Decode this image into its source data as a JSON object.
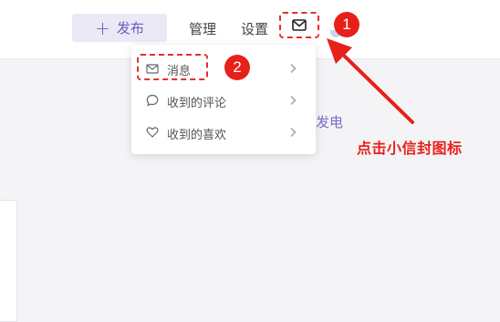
{
  "header": {
    "publish_label": "发布",
    "manage_label": "管理",
    "settings_label": "设置"
  },
  "dropdown": {
    "items": [
      {
        "label": "消息",
        "icon": "mail-icon"
      },
      {
        "label": "收到的评论",
        "icon": "comment-bubble-icon"
      },
      {
        "label": "收到的喜欢",
        "icon": "heart-icon"
      }
    ]
  },
  "background_text": "发电",
  "annotations": {
    "step1": "1",
    "step2": "2",
    "instruction": "点击小信封图标"
  },
  "colors": {
    "accent": "#6e5bc2",
    "annotation_red": "#e8201a"
  }
}
